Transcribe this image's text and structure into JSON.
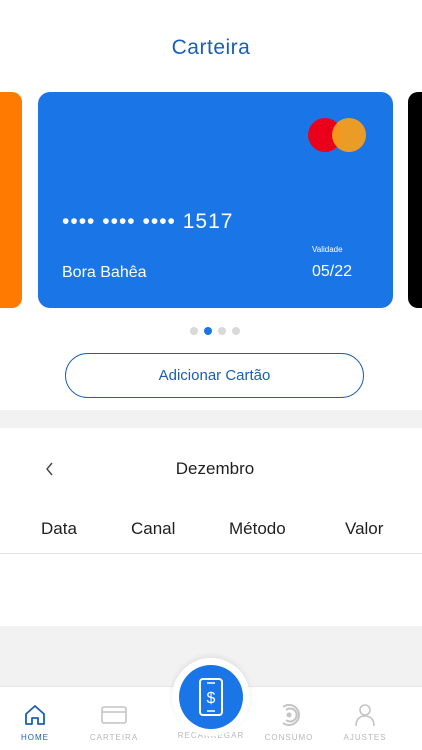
{
  "header": {
    "title": "Carteira"
  },
  "carousel": {
    "card": {
      "number": "•••• •••• •••• 1517",
      "holder": "Bora Bahêa",
      "valid_label": "Validade",
      "valid": "05/22",
      "brand_icon": "mastercard-icon",
      "color": "#1a76e6"
    },
    "left_card_color": "#ff7a00",
    "right_card_color": "#000000",
    "dots": 4,
    "active_dot": 1
  },
  "add_card_label": "Adicionar Cartão",
  "history": {
    "month": "Dezembro",
    "prev_icon": "chevron-left-icon",
    "columns": [
      "Data",
      "Canal",
      "Método",
      "Valor"
    ]
  },
  "tabbar": {
    "items": [
      {
        "label": "HOME",
        "icon": "home-icon",
        "active": true
      },
      {
        "label": "CARTEIRA",
        "icon": "card-icon",
        "active": false
      },
      {
        "label": "RECARREGAR",
        "icon": "phone-dollar-icon",
        "active": false
      },
      {
        "label": "CONSUMO",
        "icon": "consumption-icon",
        "active": false
      },
      {
        "label": "AJUSTES",
        "icon": "user-icon",
        "active": false
      }
    ]
  },
  "colors": {
    "accent": "#1a5fb4",
    "primary": "#1a76e6"
  }
}
